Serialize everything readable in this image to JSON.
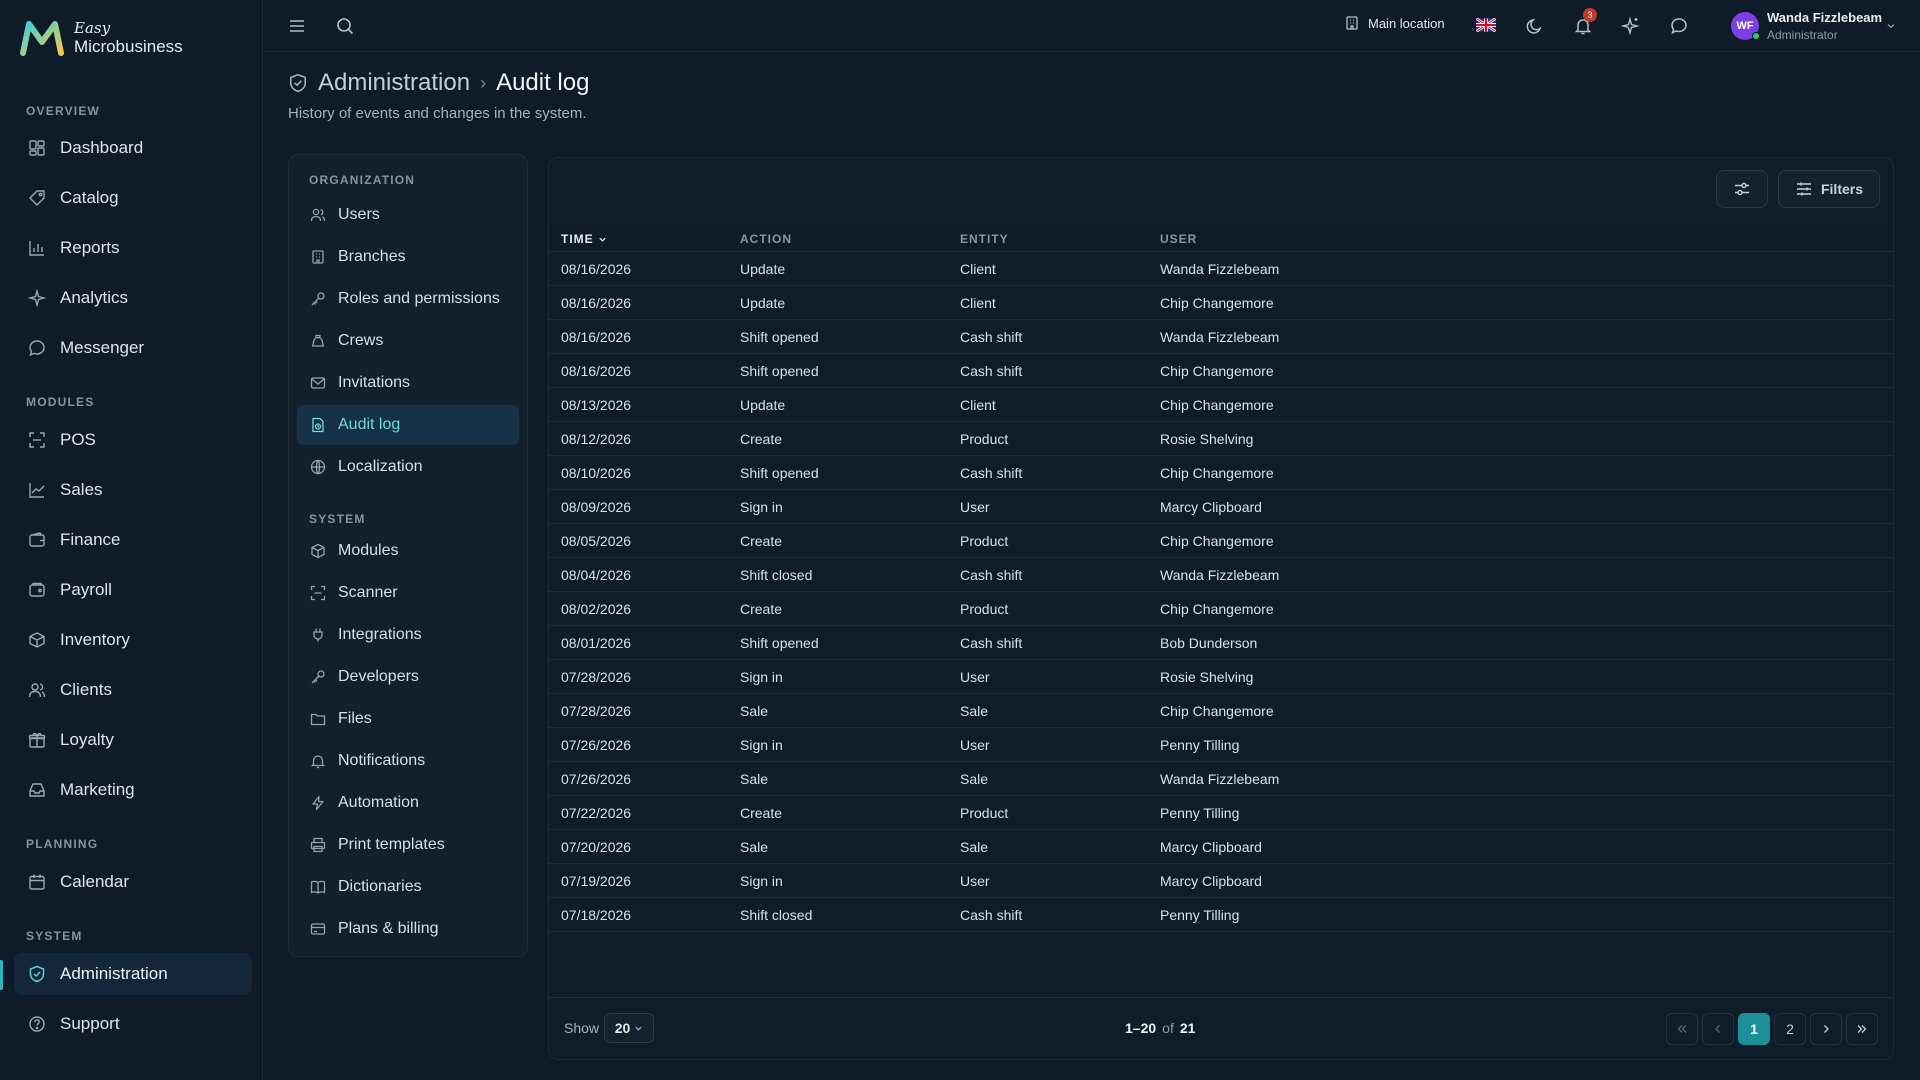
{
  "brand": {
    "line1": "Easy",
    "line2": "Microbusiness"
  },
  "sidebar": {
    "sections": [
      {
        "title": "OVERVIEW",
        "items": [
          {
            "label": "Dashboard",
            "icon": "dashboard-icon"
          },
          {
            "label": "Catalog",
            "icon": "catalog-icon"
          },
          {
            "label": "Reports",
            "icon": "reports-icon"
          },
          {
            "label": "Analytics",
            "icon": "analytics-icon"
          },
          {
            "label": "Messenger",
            "icon": "messenger-icon"
          }
        ]
      },
      {
        "title": "MODULES",
        "items": [
          {
            "label": "POS",
            "icon": "pos-icon"
          },
          {
            "label": "Sales",
            "icon": "sales-icon"
          },
          {
            "label": "Finance",
            "icon": "finance-icon"
          },
          {
            "label": "Payroll",
            "icon": "payroll-icon"
          },
          {
            "label": "Inventory",
            "icon": "inventory-icon"
          },
          {
            "label": "Clients",
            "icon": "clients-icon"
          },
          {
            "label": "Loyalty",
            "icon": "loyalty-icon"
          },
          {
            "label": "Marketing",
            "icon": "marketing-icon"
          }
        ]
      },
      {
        "title": "PLANNING",
        "items": [
          {
            "label": "Calendar",
            "icon": "calendar-icon"
          }
        ]
      },
      {
        "title": "SYSTEM",
        "items": [
          {
            "label": "Administration",
            "icon": "shield-icon",
            "active": true
          },
          {
            "label": "Support",
            "icon": "help-icon"
          }
        ]
      }
    ]
  },
  "topbar": {
    "location": "Main location",
    "notification_count": "3",
    "user": {
      "initials": "WF",
      "name": "Wanda Fizzlebeam",
      "role": "Administrator"
    }
  },
  "page": {
    "breadcrumb_parent": "Administration",
    "breadcrumb_current": "Audit log",
    "subtitle": "History of events and changes in the system."
  },
  "subnav": {
    "sections": [
      {
        "title": "ORGANIZATION",
        "items": [
          "Users",
          "Branches",
          "Roles and permissions",
          "Crews",
          "Invitations",
          "Audit log",
          "Localization"
        ]
      },
      {
        "title": "SYSTEM",
        "items": [
          "Modules",
          "Scanner",
          "Integrations",
          "Developers",
          "Files",
          "Notifications",
          "Automation",
          "Print templates",
          "Dictionaries",
          "Plans & billing"
        ]
      }
    ],
    "active": "Audit log"
  },
  "table": {
    "filters_label": "Filters",
    "columns": [
      "TIME",
      "ACTION",
      "ENTITY",
      "USER"
    ],
    "rows": [
      [
        "08/16/2026",
        "Update",
        "Client",
        "Wanda Fizzlebeam"
      ],
      [
        "08/16/2026",
        "Update",
        "Client",
        "Chip Changemore"
      ],
      [
        "08/16/2026",
        "Shift opened",
        "Cash shift",
        "Wanda Fizzlebeam"
      ],
      [
        "08/16/2026",
        "Shift opened",
        "Cash shift",
        "Chip Changemore"
      ],
      [
        "08/13/2026",
        "Update",
        "Client",
        "Chip Changemore"
      ],
      [
        "08/12/2026",
        "Create",
        "Product",
        "Rosie Shelving"
      ],
      [
        "08/10/2026",
        "Shift opened",
        "Cash shift",
        "Chip Changemore"
      ],
      [
        "08/09/2026",
        "Sign in",
        "User",
        "Marcy Clipboard"
      ],
      [
        "08/05/2026",
        "Create",
        "Product",
        "Chip Changemore"
      ],
      [
        "08/04/2026",
        "Shift closed",
        "Cash shift",
        "Wanda Fizzlebeam"
      ],
      [
        "08/02/2026",
        "Create",
        "Product",
        "Chip Changemore"
      ],
      [
        "08/01/2026",
        "Shift opened",
        "Cash shift",
        "Bob Dunderson"
      ],
      [
        "07/28/2026",
        "Sign in",
        "User",
        "Rosie Shelving"
      ],
      [
        "07/28/2026",
        "Sale",
        "Sale",
        "Chip Changemore"
      ],
      [
        "07/26/2026",
        "Sign in",
        "User",
        "Penny Tilling"
      ],
      [
        "07/26/2026",
        "Sale",
        "Sale",
        "Wanda Fizzlebeam"
      ],
      [
        "07/22/2026",
        "Create",
        "Product",
        "Penny Tilling"
      ],
      [
        "07/20/2026",
        "Sale",
        "Sale",
        "Marcy Clipboard"
      ],
      [
        "07/19/2026",
        "Sign in",
        "User",
        "Marcy Clipboard"
      ],
      [
        "07/18/2026",
        "Shift closed",
        "Cash shift",
        "Penny Tilling"
      ]
    ]
  },
  "pagination": {
    "show_label": "Show",
    "page_size": "20",
    "range": "1–20",
    "of": "of",
    "total": "21",
    "pages": [
      "1",
      "2"
    ],
    "current": "1"
  },
  "colors": {
    "accent": "#2bb5c0",
    "background": "#0f1b28",
    "active_page": "#1e8f98"
  }
}
